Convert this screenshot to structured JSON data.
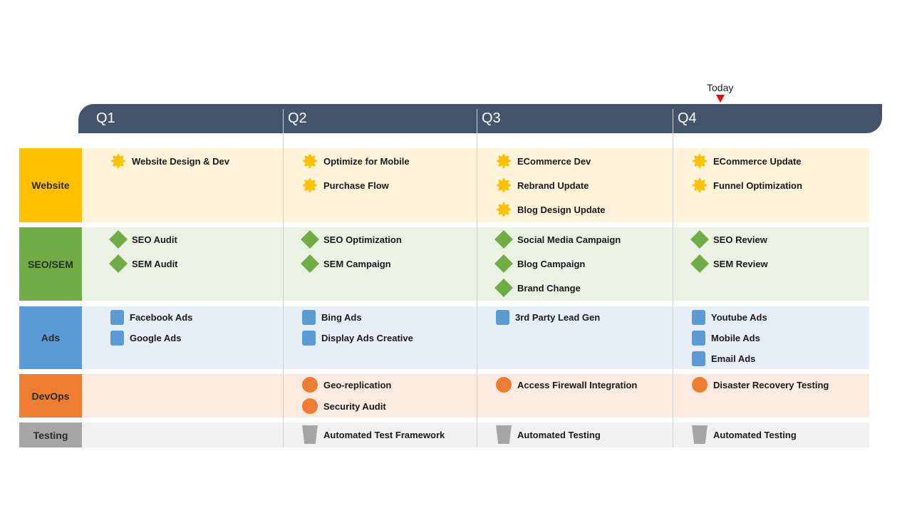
{
  "today": {
    "label": "Today",
    "marker_color": "#ff0000"
  },
  "header": {
    "bar_color": "#44546a",
    "quarters": [
      "Q1",
      "Q2",
      "Q3",
      "Q4"
    ]
  },
  "lanes": [
    {
      "name": "Website",
      "head_color": "#ffc000",
      "bg_color": "#fff4d9",
      "icon": "star-icon",
      "quarters": [
        [
          "Website Design & Dev"
        ],
        [
          "Optimize for Mobile",
          "Purchase Flow"
        ],
        [
          "ECommerce Dev",
          "Rebrand Update",
          "Blog Design Update"
        ],
        [
          "ECommerce Update",
          "Funnel Optimization"
        ]
      ]
    },
    {
      "name": "SEO/SEM",
      "head_color": "#70ad47",
      "bg_color": "#eaf2e3",
      "icon": "diamond-icon",
      "quarters": [
        [
          "SEO Audit",
          "SEM Audit"
        ],
        [
          "SEO Optimization",
          "SEM Campaign"
        ],
        [
          "Social Media Campaign",
          "Blog Campaign",
          "Brand Change"
        ],
        [
          "SEO Review",
          "SEM Review"
        ]
      ]
    },
    {
      "name": "Ads",
      "head_color": "#5b9bd5",
      "bg_color": "#e6eef8",
      "icon": "square-icon",
      "quarters": [
        [
          "Facebook Ads",
          "Google Ads"
        ],
        [
          "Bing Ads",
          "Display Ads Creative"
        ],
        [
          "3rd Party Lead Gen"
        ],
        [
          "Youtube Ads",
          "Mobile Ads",
          "Email Ads"
        ]
      ]
    },
    {
      "name": "DevOps",
      "head_color": "#ed7d31",
      "bg_color": "#fbeadf",
      "icon": "circle-icon",
      "quarters": [
        [],
        [
          "Geo-replication",
          "Security Audit"
        ],
        [
          "Access Firewall Integration"
        ],
        [
          "Disaster Recovery Testing"
        ]
      ]
    },
    {
      "name": "Testing",
      "head_color": "#a5a5a5",
      "bg_color": "#f1f1f1",
      "icon": "trapezoid-icon",
      "quarters": [
        [],
        [
          "Automated Test Framework"
        ],
        [
          "Automated Testing"
        ],
        [
          "Automated Testing"
        ]
      ]
    }
  ]
}
